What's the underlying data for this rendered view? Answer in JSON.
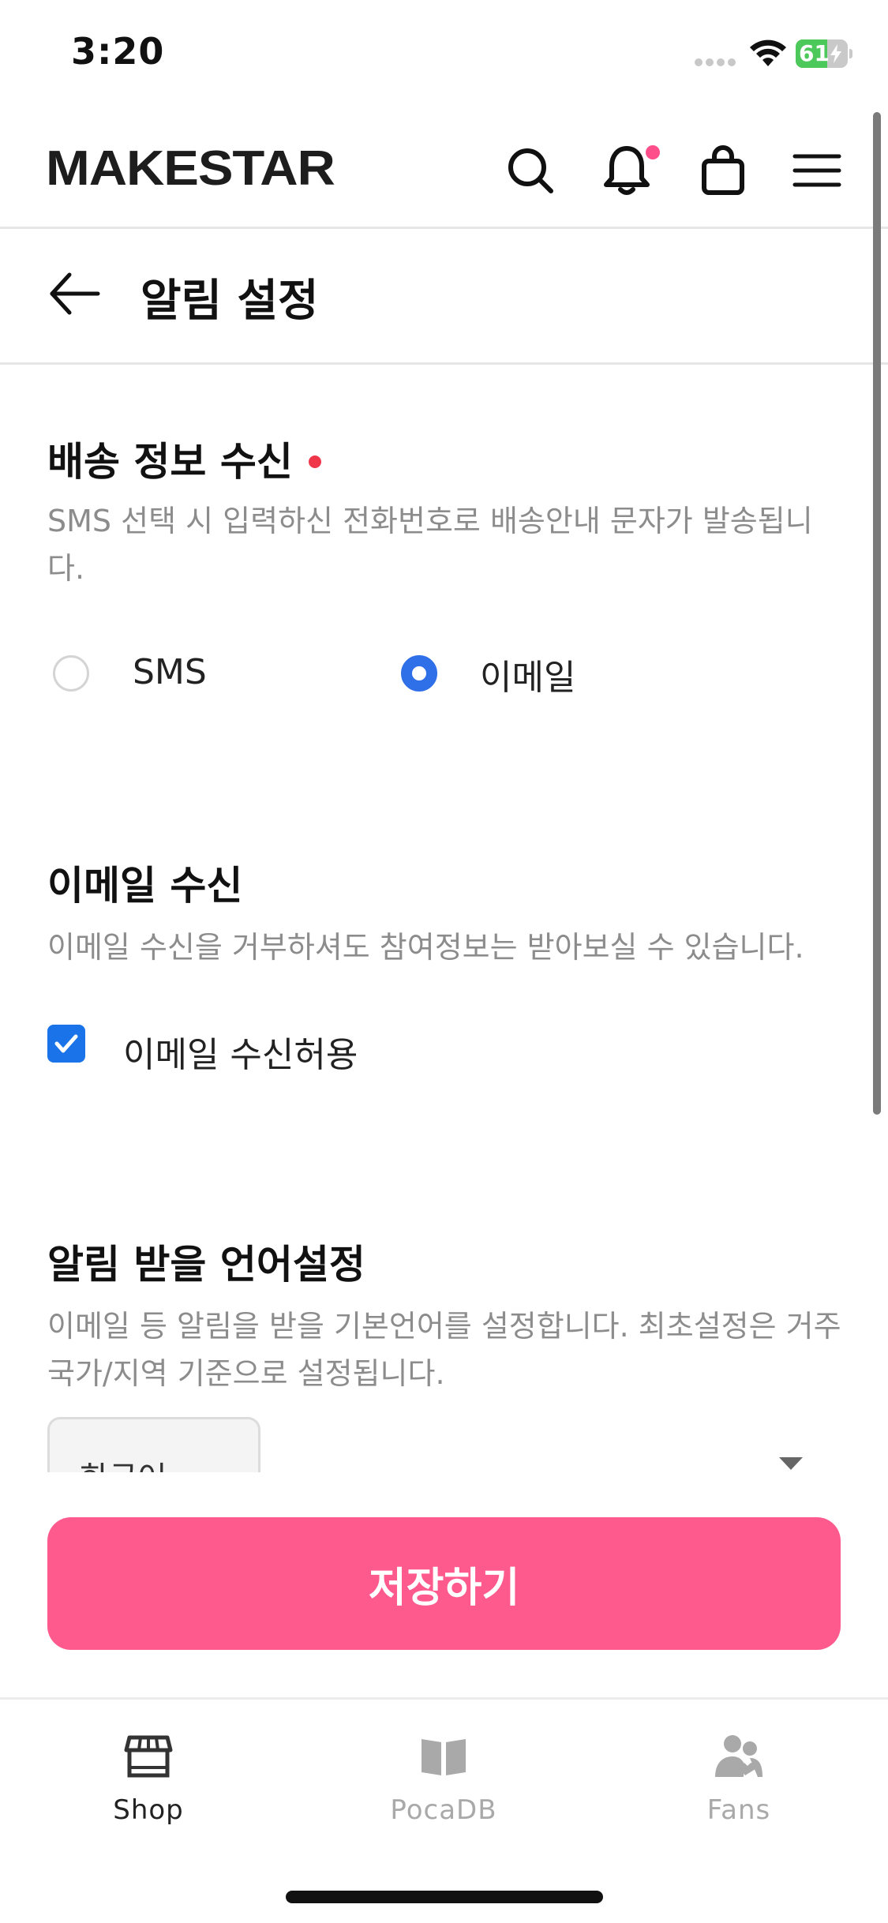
{
  "status_bar": {
    "time": "3:20",
    "battery": "61",
    "battery_level": 0.61
  },
  "header": {
    "logo": "MAKESTAR"
  },
  "title_bar": {
    "title": "알림 설정"
  },
  "delivery": {
    "title": "배송 정보 수신",
    "description": "SMS 선택 시 입력하신 전화번호로 배송안내 문자가 발송됩니다.",
    "options": [
      {
        "label": "SMS",
        "selected": false
      },
      {
        "label": "이메일",
        "selected": true
      }
    ]
  },
  "email": {
    "title": "이메일 수신",
    "description": "이메일 수신을 거부하셔도 참여정보는 받아보실 수 있습니다.",
    "checkbox_label": "이메일 수신허용",
    "checked": true
  },
  "language": {
    "title": "알림 받을 언어설정",
    "description": "이메일 등 알림을 받을 기본언어를 설정합니다. 최초설정은 거주국가/지역 기준으로 설정됩니다.",
    "selected": "한국어"
  },
  "save_button": {
    "label": "저장하기"
  },
  "bottom_nav": {
    "items": [
      {
        "label": "Shop",
        "active": true
      },
      {
        "label": "PocaDB",
        "active": false
      },
      {
        "label": "Fans",
        "active": false
      }
    ]
  },
  "colors": {
    "accent": "#ff5a8e",
    "radio_selected": "#2f6fe8",
    "checkbox": "#1a73e8",
    "required": "#f0374a",
    "nav_inactive": "#a9a9a9"
  }
}
